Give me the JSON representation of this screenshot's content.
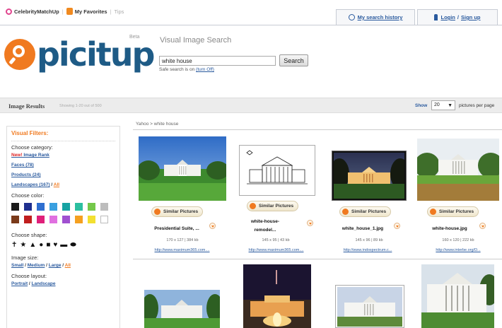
{
  "topbar": {
    "link_celebrity": "CelebrityMatchUp",
    "link_favorites": "My Favorites",
    "link_tips": "Tips",
    "tab_history": "My search history",
    "tab_login": "Login",
    "tab_signup": "Sign up",
    "login_sep": "/"
  },
  "logo": {
    "text": "picitup",
    "beta": "Beta"
  },
  "search": {
    "title": "Visual Image Search",
    "query": "white house",
    "button": "Search",
    "safe_prefix": "Safe search is on",
    "safe_link": "(turn Off)"
  },
  "results_bar": {
    "title": "Image Results",
    "count": "Showing 1-20 out of 500",
    "show_label": "Show",
    "per_page_value": "20",
    "per_page_label": "pictures per page"
  },
  "breadcrumb": "Yahoo > white house",
  "filters": {
    "title": "Visual Filters:",
    "category_label": "Choose category:",
    "category_new": "New!",
    "category_rank": " Image Rank",
    "cat_faces": "Faces (78)",
    "cat_products": "Products (24)",
    "cat_landscapes": "Landscapes (167)",
    "cat_all": "All",
    "color_label": "Choose color:",
    "colors": [
      "#1a1a1a",
      "#1f2f8f",
      "#2f6fd0",
      "#3aa0e0",
      "#17a3a3",
      "#2cbfa0",
      "#74c84a",
      "#bdbdbd",
      "#7a3a1a",
      "#c01e1e",
      "#e0207a",
      "#e070e0",
      "#a050d0",
      "#f5a020",
      "#f3e030",
      "#ffffff"
    ],
    "shape_label": "Choose shape:",
    "shapes": [
      "✝",
      "★",
      "▲",
      "●",
      "■",
      "♥",
      "▬",
      "⬬"
    ],
    "size_label": "Image size:",
    "size_small": "Small",
    "size_medium": "Medium",
    "size_large": "Large",
    "size_all": "All",
    "layout_label": "Choose layout:",
    "layout_portrait": "Portrait",
    "layout_landscape": "Landscape",
    "slash": " / "
  },
  "similar_label": "Similar Pictures",
  "results": [
    {
      "caption": "Presidential Suite, ...",
      "meta": "170 x 127 | 384 kb",
      "url": "http://www.maximum365.com...."
    },
    {
      "caption": "white-house-remodel...",
      "meta": "145 x 95 | 43 kb",
      "url": "http://www.maximum365.com...."
    },
    {
      "caption": "white_house_1.jpg",
      "meta": "145 x 96 | 89 kb",
      "url": "http://www.indospectrum.c..."
    },
    {
      "caption": "white-house.jpg",
      "meta": "160 x 120 | 222 kb",
      "url": "http://www.interbe.org/D..."
    }
  ]
}
